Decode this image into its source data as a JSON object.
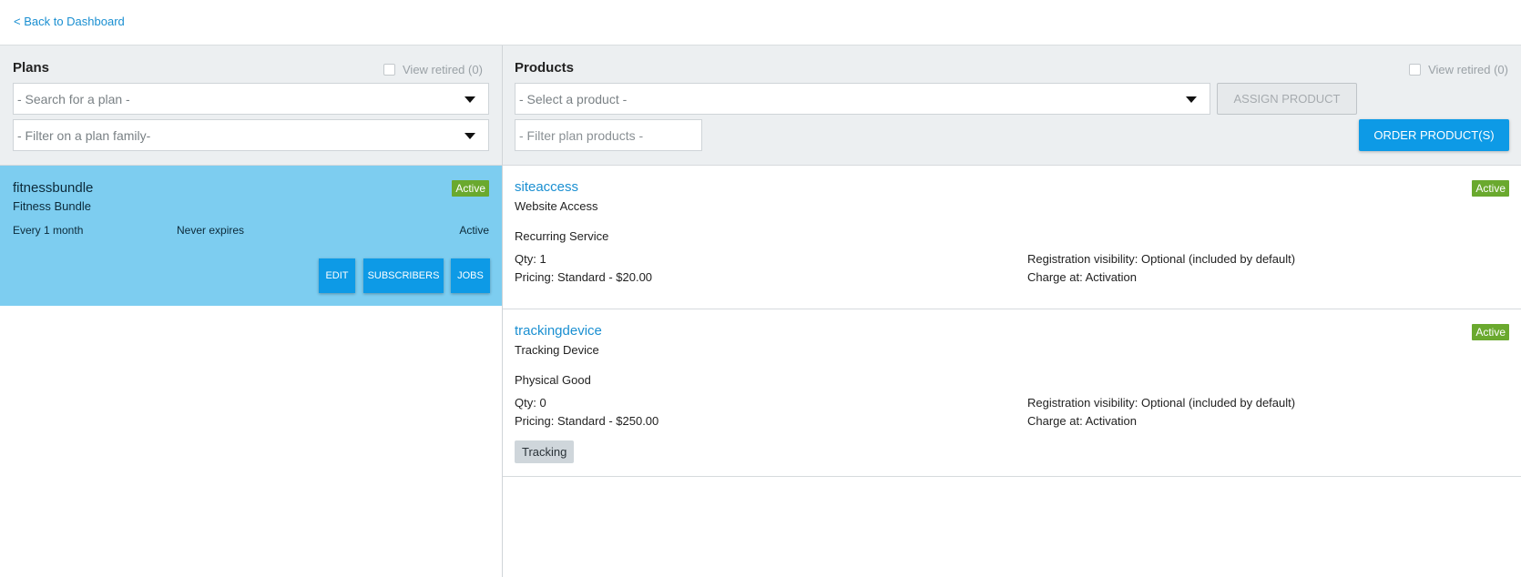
{
  "topbar": {
    "back_label": "< Back to Dashboard"
  },
  "plans": {
    "title": "Plans",
    "retired_label": "View retired (0)",
    "search_placeholder": "- Search for a plan -",
    "family_placeholder": "- Filter on a plan family-",
    "selected_plan": {
      "code": "fitnessbundle",
      "name": "Fitness Bundle",
      "status_badge": "Active",
      "period": "Every 1 month",
      "expiry": "Never expires",
      "status_text": "Active",
      "buttons": {
        "edit": "EDIT",
        "subscribers": "SUBSCRIBERS",
        "jobs": "JOBS"
      }
    }
  },
  "products": {
    "title": "Products",
    "retired_label": "View retired (0)",
    "select_placeholder": "- Select a product -",
    "assign_label": "ASSIGN PRODUCT",
    "filter_placeholder": "- Filter plan products -",
    "order_label": "ORDER PRODUCT(S)",
    "items": [
      {
        "code": "siteaccess",
        "name": "Website Access",
        "status": "Active",
        "type": "Recurring Service",
        "qty": "Qty: 1",
        "pricing": "Pricing: Standard - $20.00",
        "visibility": "Registration visibility: Optional (included by default)",
        "charge": "Charge at:  Activation"
      },
      {
        "code": "trackingdevice",
        "name": "Tracking Device",
        "status": "Active",
        "type": "Physical Good",
        "qty": "Qty: 0",
        "pricing": "Pricing: Standard - $250.00",
        "visibility": "Registration visibility: Optional (included by default)",
        "charge": "Charge at:  Activation",
        "tag": "Tracking"
      }
    ]
  },
  "colors": {
    "accent": "#0d9ae6",
    "link": "#1a8fd1",
    "selected_card": "#7dcdf0",
    "active_badge": "#6aa92e"
  }
}
